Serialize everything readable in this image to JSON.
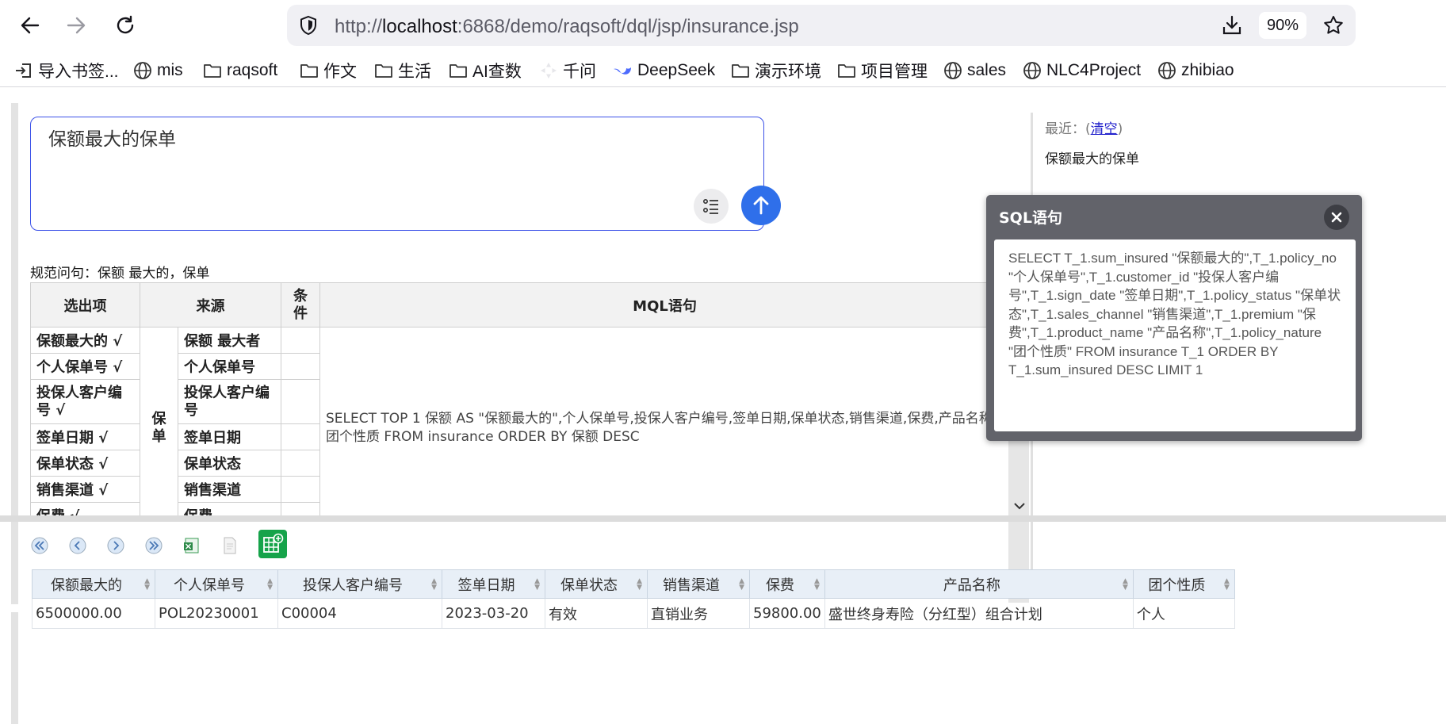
{
  "browser": {
    "url_prefix": "http://",
    "url_host": "localhost",
    "url_rest": ":6868/demo/raqsoft/dql/jsp/insurance.jsp",
    "zoom": "90%",
    "bookmarks": [
      {
        "label": "导入书签...",
        "icon": "import-icon"
      },
      {
        "label": "mis",
        "icon": "globe-icon"
      },
      {
        "label": "raqsoft",
        "icon": "folder-icon"
      },
      {
        "label": "作文",
        "icon": "folder-icon"
      },
      {
        "label": "生活",
        "icon": "folder-icon"
      },
      {
        "label": "AI查数",
        "icon": "folder-icon"
      },
      {
        "label": "千问",
        "icon": "qianwen-icon"
      },
      {
        "label": "DeepSeek",
        "icon": "deepseek-icon"
      },
      {
        "label": "演示环境",
        "icon": "folder-icon"
      },
      {
        "label": "项目管理",
        "icon": "folder-icon"
      },
      {
        "label": "sales",
        "icon": "globe-icon"
      },
      {
        "label": "NLC4Project",
        "icon": "globe-icon"
      },
      {
        "label": "zhibiao",
        "icon": "globe-icon"
      }
    ]
  },
  "query": {
    "text": "保额最大的保单",
    "normalized_label": "规范问句：保额 最大的，保单"
  },
  "mql_table": {
    "headers": {
      "output": "选出项",
      "source": "来源",
      "condition": "条\n件",
      "mql": "MQL语句"
    },
    "group_label": "保\n单",
    "rows": [
      {
        "output": "保额最大的 √",
        "source": "保额 最大者"
      },
      {
        "output": "个人保单号 √",
        "source": "个人保单号"
      },
      {
        "output": "投保人客户编号 √",
        "source": "投保人客户编号"
      },
      {
        "output": "签单日期 √",
        "source": "签单日期"
      },
      {
        "output": "保单状态 √",
        "source": "保单状态"
      },
      {
        "output": "销售渠道 √",
        "source": "销售渠道"
      },
      {
        "output": "保费 √",
        "source": "保费"
      }
    ],
    "mql": "SELECT TOP 1 保额 AS \"保额最大的\",个人保单号,投保人客户编号,签单日期,保单状态,销售渠道,保费,产品名称,团个性质 FROM insurance ORDER BY 保额 DESC"
  },
  "recent": {
    "label": "最近：(",
    "clear": "清空",
    "close_paren": ")",
    "items": [
      "保额最大的保单"
    ]
  },
  "sql_popup": {
    "title": "SQL语句",
    "sql": "SELECT T_1.sum_insured \"保额最大的\",T_1.policy_no \"个人保单号\",T_1.customer_id \"投保人客户编号\",T_1.sign_date \"签单日期\",T_1.policy_status \"保单状态\",T_1.sales_channel \"销售渠道\",T_1.premium \"保费\",T_1.product_name \"产品名称\",T_1.policy_nature \"团个性质\" FROM insurance T_1 ORDER BY T_1.sum_insured DESC LIMIT 1"
  },
  "results": {
    "columns": [
      "保额最大的",
      "个人保单号",
      "投保人客户编号",
      "签单日期",
      "保单状态",
      "销售渠道",
      "保费",
      "产品名称",
      "团个性质"
    ],
    "rows": [
      [
        "6500000.00",
        "POL20230001",
        "C00004",
        "2023-03-20",
        "有效",
        "直销业务",
        "59800.00",
        "盛世终身寿险（分红型）组合计划",
        "个人"
      ]
    ]
  },
  "colors": {
    "accent": "#2f6fea",
    "popup": "#62636a",
    "excel": "#16a34a"
  }
}
